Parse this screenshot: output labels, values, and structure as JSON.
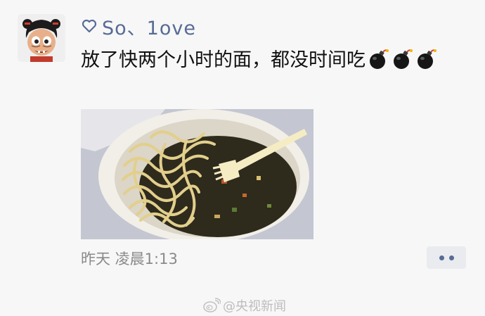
{
  "post": {
    "username": "So、1ove",
    "text": "放了快两个小时的面，都没时间吃",
    "emojis": [
      "bomb-icon",
      "bomb-icon",
      "bomb-icon"
    ],
    "timestamp": "昨天 凌晨1:13"
  },
  "actions": {
    "more_icon": "more-dots-icon"
  },
  "watermark": {
    "text": "@央视新闻"
  },
  "colors": {
    "background": "#f7f7f7",
    "username": "#576b95",
    "text": "#111111",
    "timestamp": "#8a8a8a",
    "more_button_bg": "#e9ebef"
  }
}
